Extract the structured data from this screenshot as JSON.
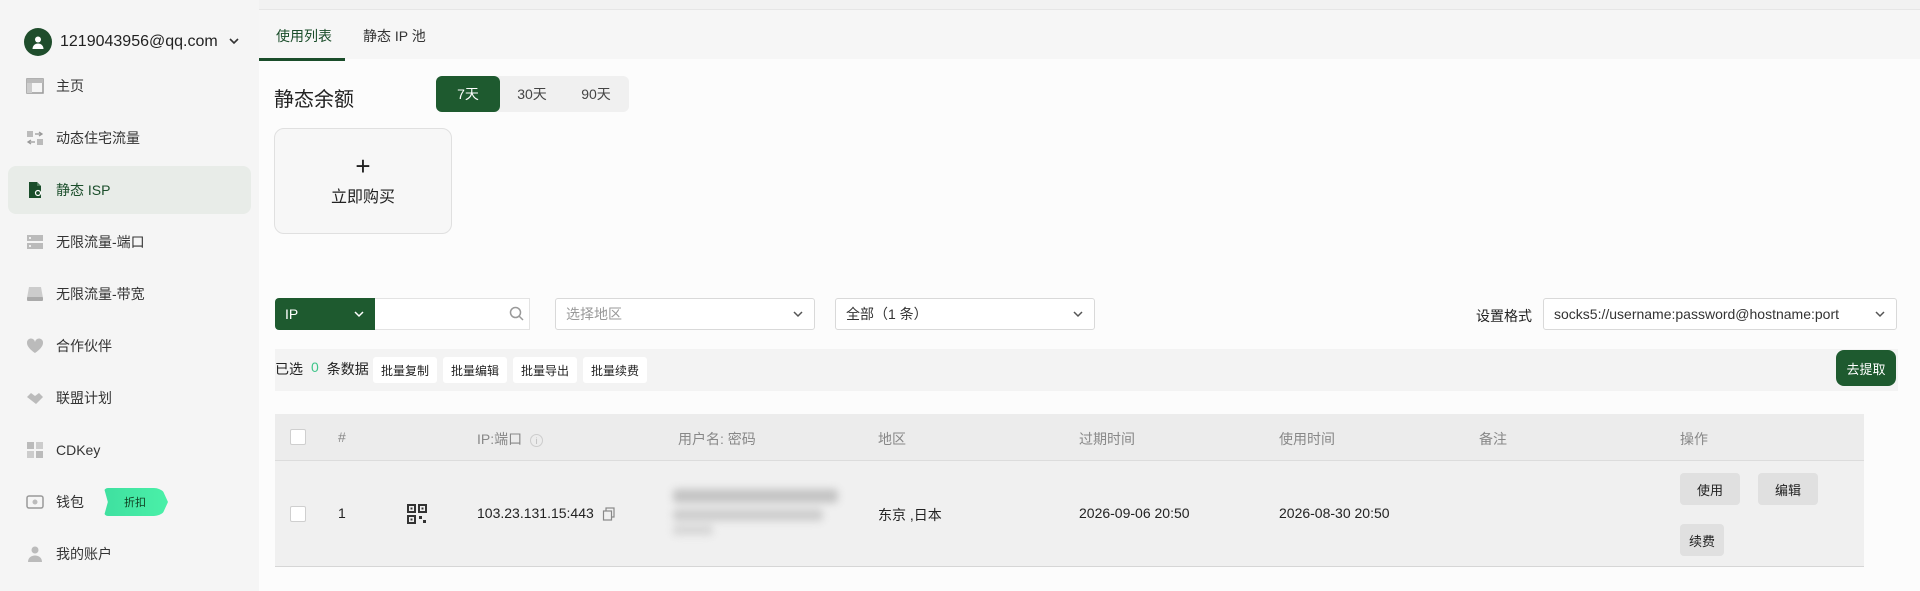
{
  "user": {
    "email": "1219043956@qq.com"
  },
  "sidebar": {
    "items": [
      {
        "label": "主页",
        "icon": "home-icon"
      },
      {
        "label": "动态住宅流量",
        "icon": "swap-icon"
      },
      {
        "label": "静态 ISP",
        "icon": "file-icon",
        "active": true
      },
      {
        "label": "无限流量-端口",
        "icon": "server-icon"
      },
      {
        "label": "无限流量-带宽",
        "icon": "drive-icon"
      },
      {
        "label": "合作伙伴",
        "icon": "heart-icon"
      },
      {
        "label": "联盟计划",
        "icon": "handshake-icon"
      },
      {
        "label": "CDKey",
        "icon": "grid-icon"
      },
      {
        "label": "钱包",
        "icon": "wallet-icon",
        "badge": "折扣"
      },
      {
        "label": "我的账户",
        "icon": "person-icon"
      }
    ]
  },
  "tabs": [
    {
      "label": "使用列表",
      "active": true
    },
    {
      "label": "静态 IP 池"
    }
  ],
  "balance": {
    "title": "静态余额",
    "ranges": [
      {
        "label": "7天",
        "active": true
      },
      {
        "label": "30天"
      },
      {
        "label": "90天"
      }
    ],
    "buy_plus": "+",
    "buy_label": "立即购买"
  },
  "filters": {
    "type_value": "IP",
    "search_value": "",
    "region_placeholder": "选择地区",
    "status_value": "全部（1 条）",
    "format_label": "设置格式",
    "format_value": "socks5://username:password@hostname:port"
  },
  "bulk": {
    "selected_prefix": "已选",
    "selected_count": "0",
    "selected_suffix": "条数据",
    "copy": "批量复制",
    "edit": "批量编辑",
    "export": "批量导出",
    "renew": "批量续费",
    "extract": "去提取"
  },
  "table": {
    "columns": {
      "index": "#",
      "ip_port": "IP:端口",
      "credentials": "用户名: 密码",
      "region": "地区",
      "expire": "过期时间",
      "use_time": "使用时间",
      "note": "备注",
      "actions": "操作"
    },
    "rows": [
      {
        "index": "1",
        "ip_port": "103.23.131.15:443",
        "credentials": "",
        "region": "东京 ,日本",
        "expire": "2026-09-06 20:50",
        "use_time": "2026-08-30 20:50",
        "note": "",
        "use_label": "使用",
        "edit_label": "编辑",
        "renew_label": "续费"
      }
    ]
  },
  "colors": {
    "brand": "#1e5a2f",
    "active_bg": "#e8ece8",
    "highlight": "#3fc58a"
  }
}
